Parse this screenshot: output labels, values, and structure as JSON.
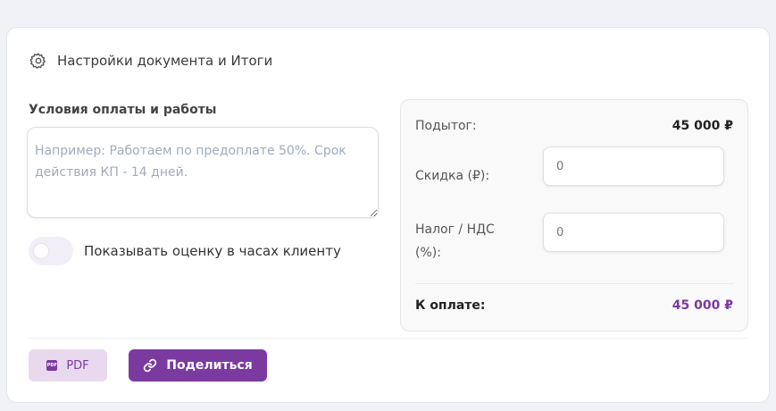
{
  "section": {
    "title": "Настройки документа и Итоги",
    "icon": "gear-icon"
  },
  "terms": {
    "label": "Условия оплаты и работы",
    "placeholder": "Например: Работаем по предоплате 50%. Срок действия КП - 14 дней.",
    "value": ""
  },
  "toggle": {
    "label": "Показывать оценку в часах клиенту",
    "checked": false
  },
  "totals": {
    "subtotal_label": "Подытог:",
    "subtotal_value": "45 000 ₽",
    "discount_label": "Скидка (₽):",
    "discount_placeholder": "0",
    "tax_label": "Налог / НДС (%):",
    "tax_placeholder": "0",
    "total_label": "К оплате:",
    "total_value": "45 000 ₽"
  },
  "actions": {
    "pdf_label": "PDF",
    "pdf_icon": "pdf-file-icon",
    "share_label": "Поделиться",
    "share_icon": "link-icon"
  },
  "colors": {
    "accent": "#7b3aa0",
    "accent_light": "#e9d9ee",
    "background": "#f0f2f7"
  }
}
